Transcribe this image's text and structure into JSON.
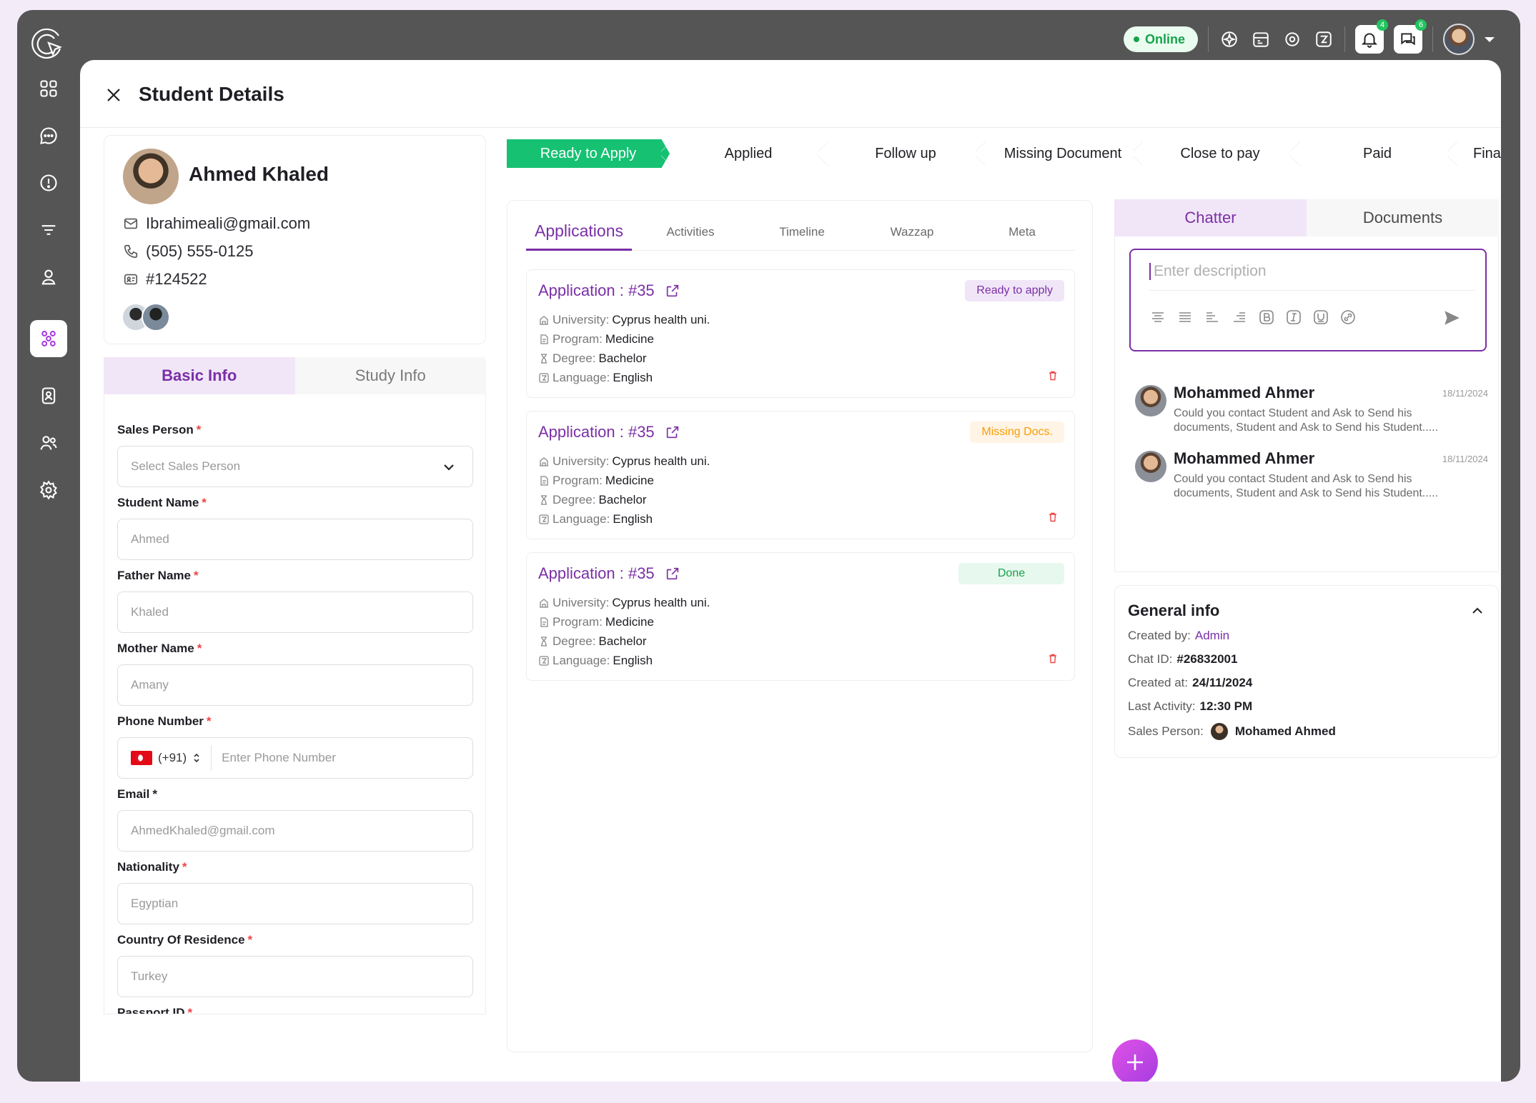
{
  "header": {
    "online_label": "Online",
    "notifications_count": "4",
    "messages_count": "6"
  },
  "page": {
    "title": "Student Details"
  },
  "profile": {
    "name": "Ahmed Khaled",
    "email": "Ibrahimeali@gmail.com",
    "phone": "(505) 555-0125",
    "id": "#124522"
  },
  "info_tabs": [
    {
      "label": "Basic Info"
    },
    {
      "label": "Study Info"
    }
  ],
  "form": {
    "sales_person": {
      "label": "Sales Person",
      "placeholder": "Select Sales Person"
    },
    "student_name": {
      "label": "Student Name",
      "value": "Ahmed"
    },
    "father_name": {
      "label": "Father Name",
      "value": "Khaled"
    },
    "mother_name": {
      "label": "Mother Name",
      "value": "Amany"
    },
    "phone_number": {
      "label": "Phone Number",
      "country_code": "(+91)",
      "placeholder": "Enter Phone Number"
    },
    "email": {
      "label": "Email",
      "value": "AhmedKhaled@gmail.com"
    },
    "nationality": {
      "label": "Nationality",
      "value": "Egyptian"
    },
    "country": {
      "label": "Country Of Residence",
      "value": "Turkey"
    },
    "passport": {
      "label": "Passport ID"
    }
  },
  "pipeline": [
    {
      "label": "Ready to Apply"
    },
    {
      "label": "Applied"
    },
    {
      "label": "Follow up"
    },
    {
      "label": "Missing Document"
    },
    {
      "label": "Close to pay"
    },
    {
      "label": "Paid"
    },
    {
      "label": "Final A"
    }
  ],
  "app_tabs": [
    {
      "label": "Applications"
    },
    {
      "label": "Activities"
    },
    {
      "label": "Timeline"
    },
    {
      "label": "Wazzap"
    },
    {
      "label": "Meta"
    }
  ],
  "field_labels": {
    "university": "University:",
    "program": "Program:",
    "degree": "Degree:",
    "language": "Language:"
  },
  "applications": [
    {
      "title": "Application : #35",
      "status": "Ready to apply",
      "university": "Cyprus health uni.",
      "program": "Medicine",
      "degree": "Bachelor",
      "language": "English"
    },
    {
      "title": "Application : #35",
      "status": "Missing Docs.",
      "university": "Cyprus health uni.",
      "program": "Medicine",
      "degree": "Bachelor",
      "language": "English"
    },
    {
      "title": "Application : #35",
      "status": "Done",
      "university": "Cyprus health uni.",
      "program": "Medicine",
      "degree": "Bachelor",
      "language": "English"
    }
  ],
  "chatter": {
    "tabs": [
      {
        "label": "Chatter"
      },
      {
        "label": "Documents"
      }
    ],
    "placeholder": "Enter description",
    "messages": [
      {
        "name": "Mohammed Ahmer",
        "date": "18/11/2024",
        "text": "Could you contact Student and Ask to Send his documents, Student and Ask to Send his Student....."
      },
      {
        "name": "Mohammed Ahmer",
        "date": "18/11/2024",
        "text": "Could you contact Student and Ask to Send his documents, Student and Ask to Send his Student....."
      }
    ]
  },
  "general_info": {
    "title": "General info",
    "created_by_label": "Created by:",
    "created_by": "Admin",
    "chat_id_label": "Chat ID:",
    "chat_id": "#26832001",
    "created_at_label": "Created at:",
    "created_at": "24/11/2024",
    "last_activity_label": "Last Activity:",
    "last_activity": "12:30 PM",
    "sales_person_label": "Sales Person:",
    "sales_person": "Mohamed Ahmed"
  },
  "colors": {
    "accent": "#7a2fa6",
    "success": "#16c172",
    "frame": "#555555"
  }
}
